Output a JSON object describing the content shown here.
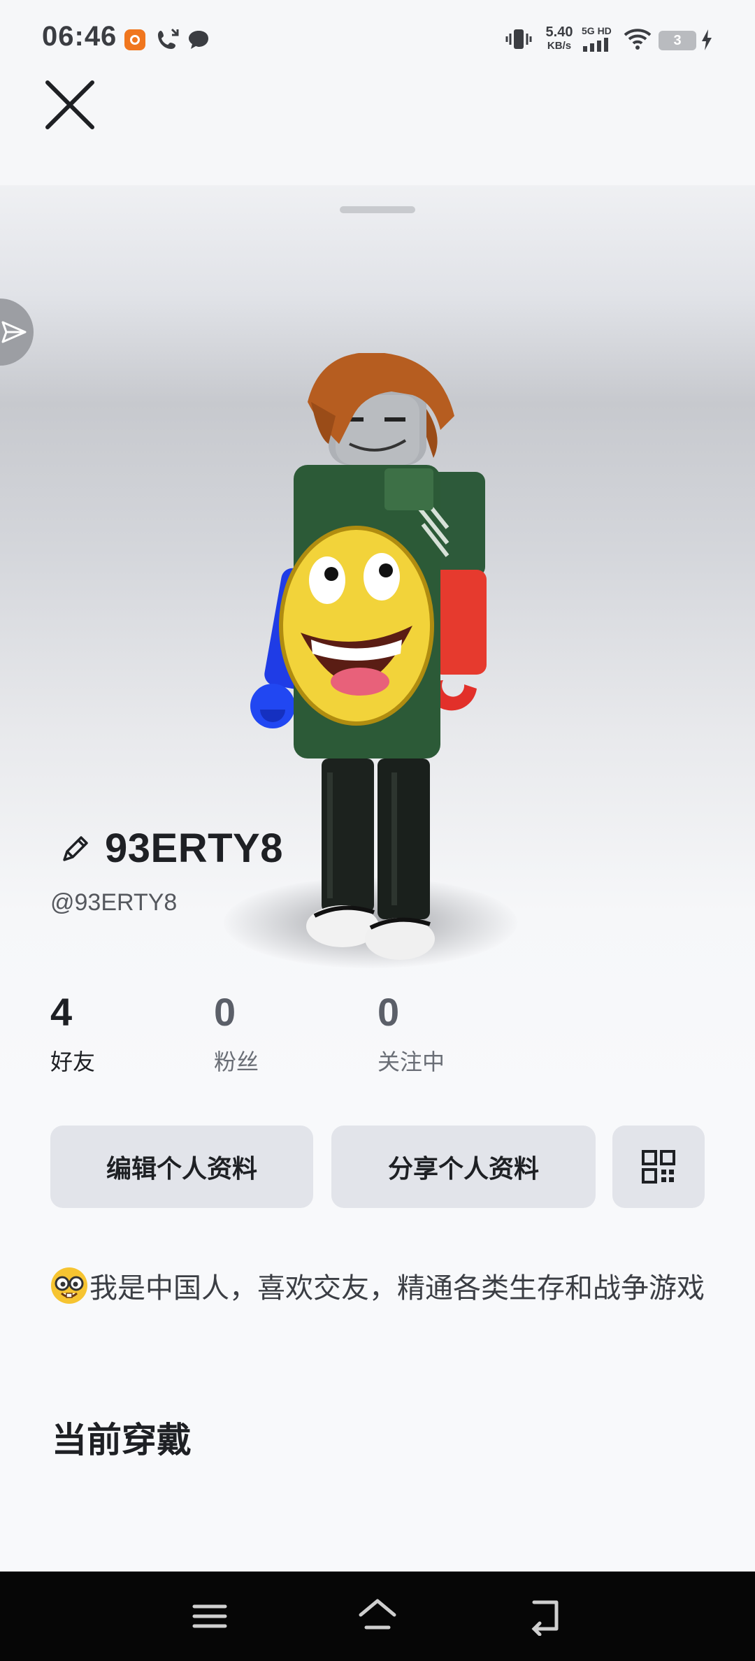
{
  "status_bar": {
    "time": "06:46",
    "net_speed_value": "5.40",
    "net_speed_unit": "KB/s",
    "signal_label": "5G HD",
    "battery_level": "3"
  },
  "profile": {
    "display_name": "93ERTY8",
    "username": "@93ERTY8",
    "stats": [
      {
        "value": "4",
        "label": "好友"
      },
      {
        "value": "0",
        "label": "粉丝"
      },
      {
        "value": "0",
        "label": "关注中"
      }
    ],
    "edit_button_label": "编辑个人资料",
    "share_button_label": "分享个人资料",
    "bio": "我是中国人，喜欢交友，精通各类生存和战争游戏",
    "current_outfit_title": "当前穿戴"
  },
  "icons": {
    "close": "close-icon",
    "share": "paper-plane-icon",
    "edit": "pencil-icon",
    "qr": "qr-code-icon",
    "bio_emoji": "nerd-face-emoji",
    "nav": [
      "menu-icon",
      "home-icon",
      "back-icon"
    ]
  },
  "colors": {
    "button_bg": "#e2e4ea",
    "text_primary": "#1e2024",
    "text_secondary": "#5b5f68",
    "nav_bar": "#060606"
  }
}
